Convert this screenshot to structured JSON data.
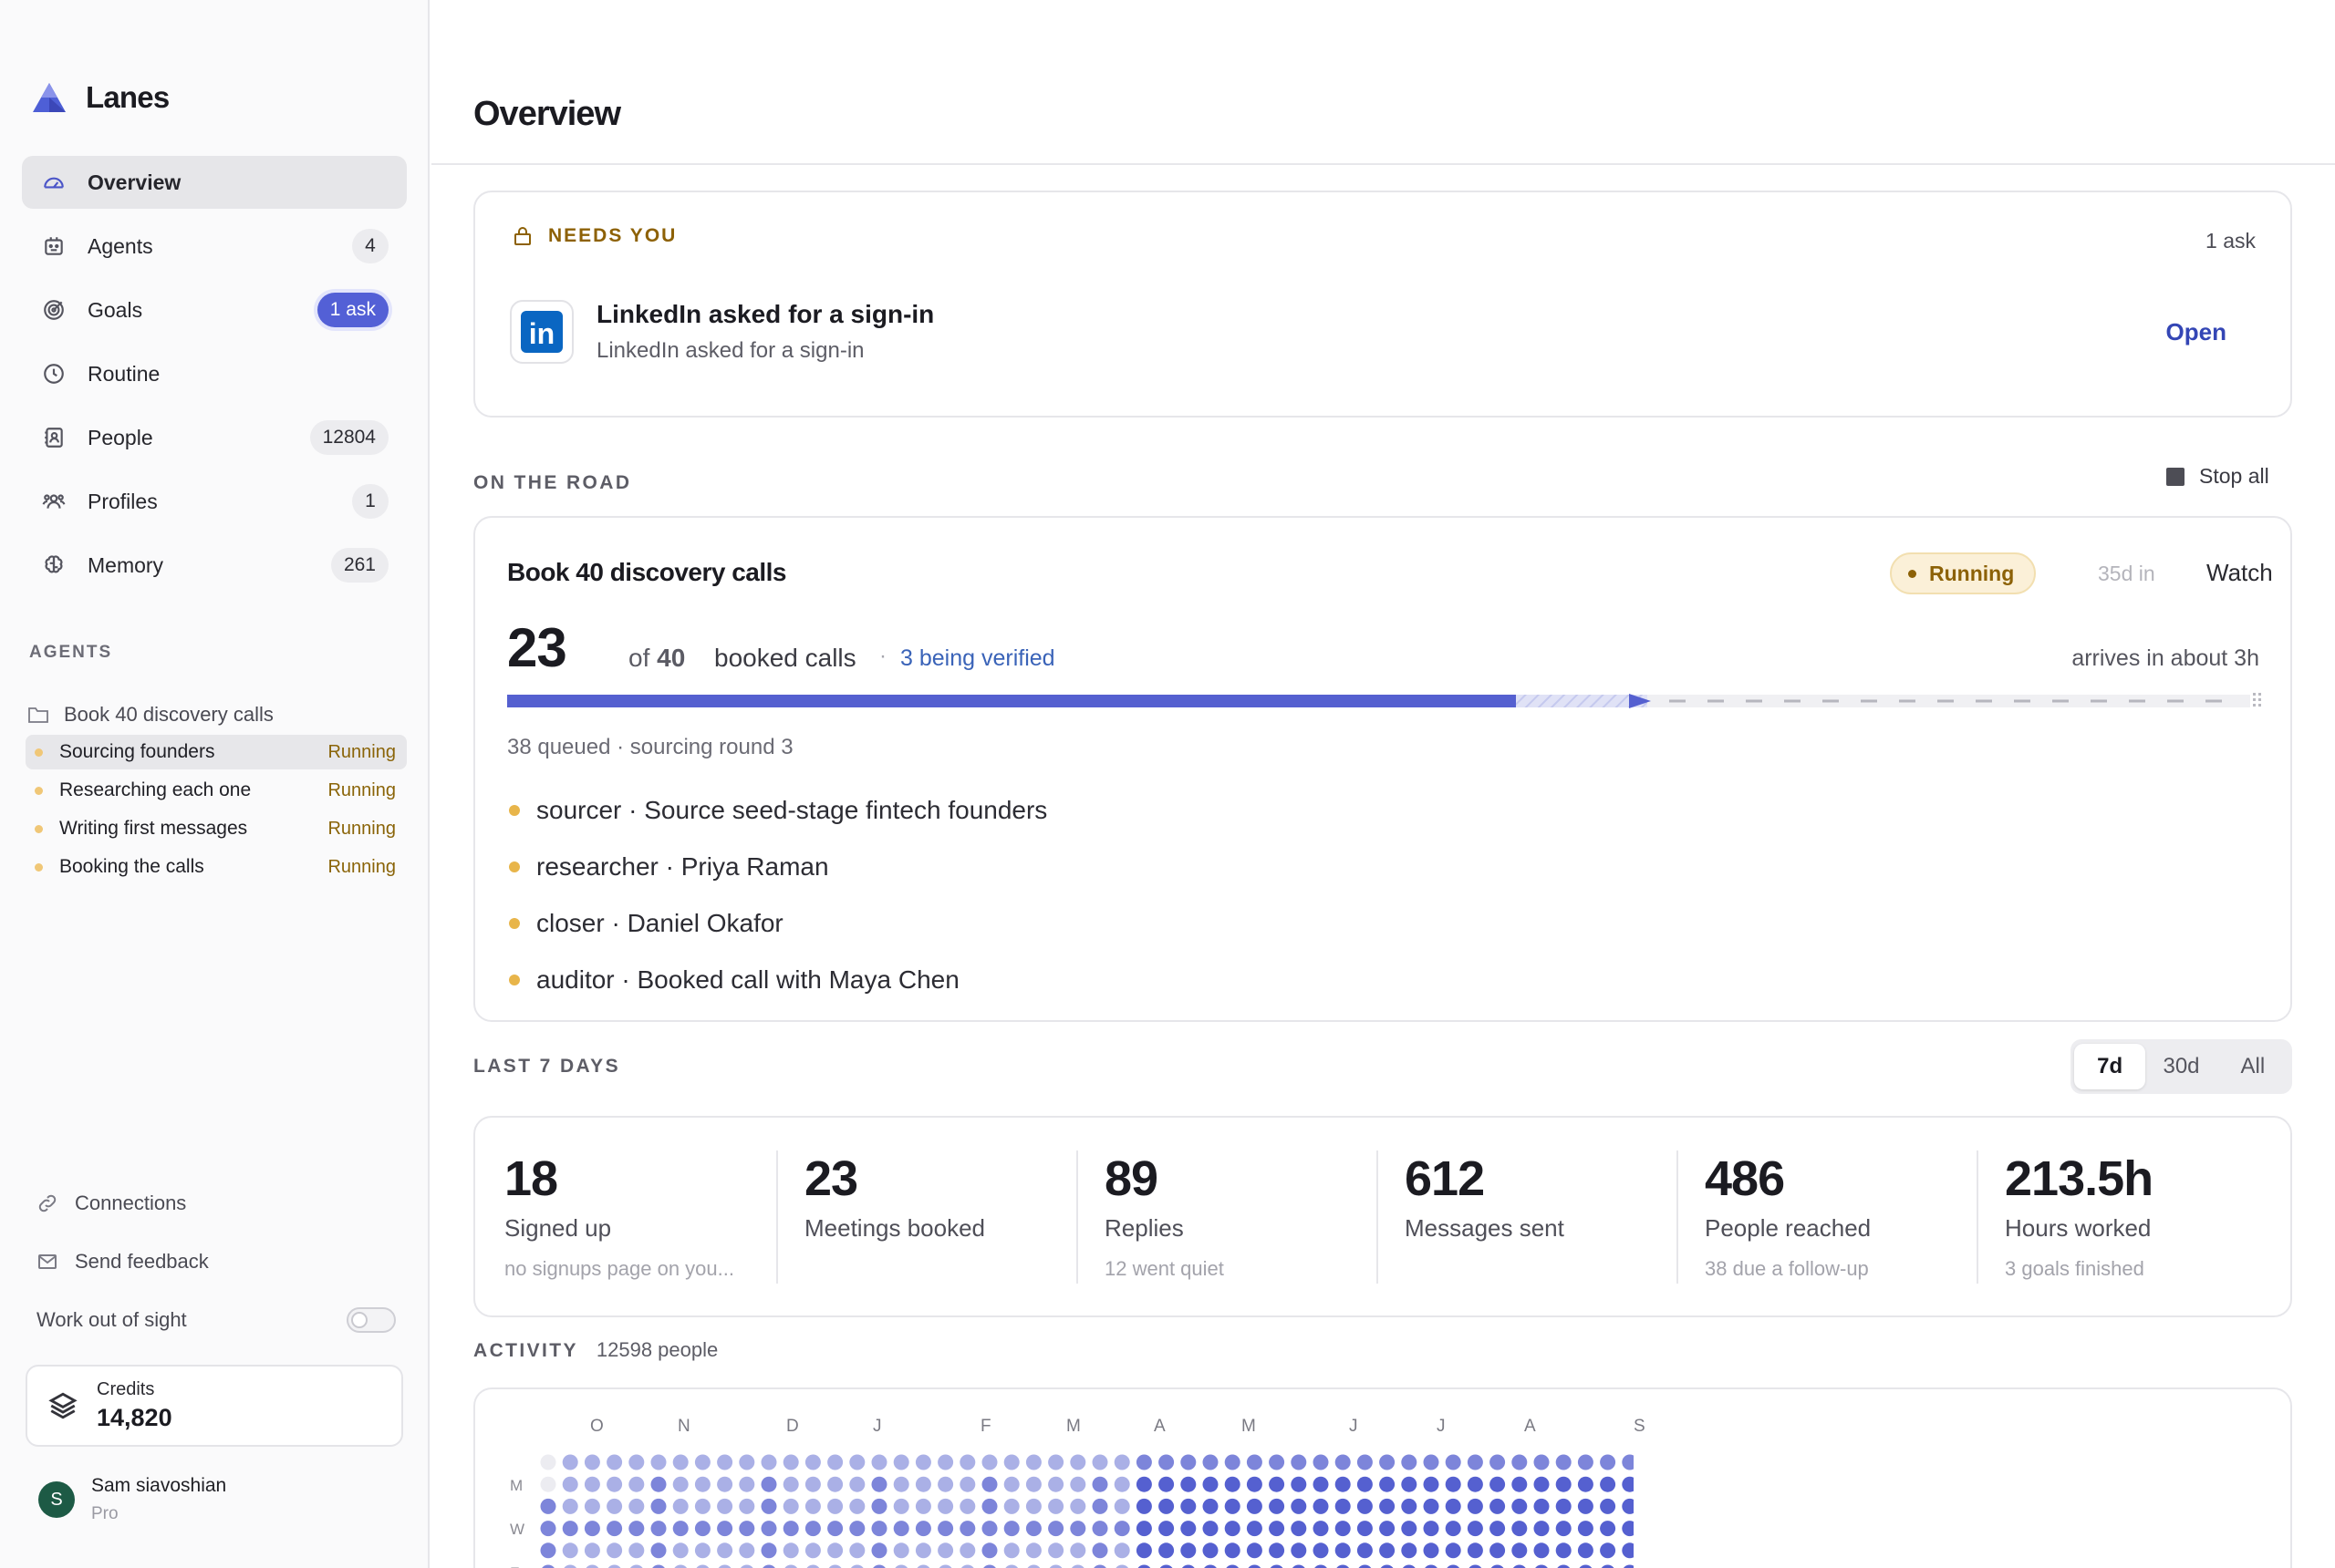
{
  "app": {
    "name": "Lanes"
  },
  "sidebar": {
    "nav": [
      {
        "label": "Overview",
        "icon": "gauge-icon",
        "count": "",
        "active": true
      },
      {
        "label": "Agents",
        "icon": "robot-icon",
        "count": "4"
      },
      {
        "label": "Goals",
        "icon": "target-icon",
        "count": "1 ask",
        "accent": true
      },
      {
        "label": "Routine",
        "icon": "clock-icon",
        "count": ""
      },
      {
        "label": "People",
        "icon": "contact-book-icon",
        "count": "12804"
      },
      {
        "label": "Profiles",
        "icon": "users-icon",
        "count": "1"
      },
      {
        "label": "Memory",
        "icon": "brain-icon",
        "count": "261"
      }
    ],
    "agents_title": "AGENTS",
    "agent_group": "Book 40 discovery calls",
    "agents": [
      {
        "name": "Sourcing founders",
        "status": "Running"
      },
      {
        "name": "Researching each one",
        "status": "Running"
      },
      {
        "name": "Writing first messages",
        "status": "Running"
      },
      {
        "name": "Booking the calls",
        "status": "Running"
      }
    ],
    "connections": "Connections",
    "feedback": "Send feedback",
    "work_out_of_sight": "Work out of sight",
    "credits_label": "Credits",
    "credits_value": "14,820",
    "user_initial": "S",
    "user_name": "Sam siavoshian",
    "user_plan": "Pro"
  },
  "main": {
    "title": "Overview",
    "needs": {
      "heading": "NEEDS YOU",
      "count": "1 ask",
      "logo_text": "in",
      "title": "LinkedIn asked for a sign-in",
      "subtitle": "LinkedIn asked for a sign-in",
      "action": "Open"
    },
    "road": {
      "section": "ON THE ROAD",
      "stop_all": "Stop all",
      "title": "Book 40 discovery calls",
      "status": "Running",
      "elapsed": "35d in",
      "watch": "Watch",
      "done": "23",
      "of_prefix": "of",
      "total": "40",
      "unit": "booked calls",
      "separator": "·",
      "verifying": "3 being verified",
      "eta": "arrives in about 3h",
      "progress_done": 0.575,
      "progress_verifying": 0.65,
      "queued": "38 queued · sourcing round 3",
      "tasks": [
        "sourcer · Source seed-stage fintech founders",
        "researcher · Priya Raman",
        "closer · Daniel Okafor",
        "auditor · Booked call with Maya Chen"
      ]
    },
    "last7": {
      "section": "LAST 7 DAYS",
      "ranges": [
        "7d",
        "30d",
        "All"
      ],
      "selected": "7d",
      "stats": [
        {
          "value": "18",
          "label": "Signed up",
          "sub": "no signups page on you..."
        },
        {
          "value": "23",
          "label": "Meetings booked",
          "sub": ""
        },
        {
          "value": "89",
          "label": "Replies",
          "sub": "12 went quiet"
        },
        {
          "value": "612",
          "label": "Messages sent",
          "sub": ""
        },
        {
          "value": "486",
          "label": "People reached",
          "sub": "38 due a follow-up"
        },
        {
          "value": "213.5h",
          "label": "Hours worked",
          "sub": "3 goals finished"
        }
      ]
    },
    "activity": {
      "section": "ACTIVITY",
      "count": "12598 people",
      "months": [
        "O",
        "N",
        "D",
        "J",
        "F",
        "M",
        "A",
        "M",
        "J",
        "J",
        "A",
        "S"
      ],
      "days": [
        "M",
        "W",
        "F"
      ],
      "colors": {
        "empty": "#ececf1",
        "light": "#aab0e6",
        "medium": "#7d85da",
        "dark": "#5560d0"
      }
    }
  },
  "colors": {
    "accent": "#5360d6",
    "running": "#8c6106",
    "link": "#3446b5"
  }
}
